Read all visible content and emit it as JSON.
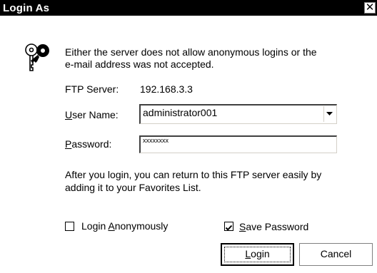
{
  "window": {
    "title": "Login As",
    "close_glyph": "✕"
  },
  "message": {
    "icon": "keys-icon",
    "line1": "Either the server does not allow anonymous logins or the",
    "line2": "e-mail address was not accepted."
  },
  "server": {
    "label": "FTP Server:",
    "value": "192.168.3.3"
  },
  "username": {
    "label_accel": "U",
    "label_rest": "ser Name:",
    "value": "administrator001"
  },
  "password": {
    "label_accel": "P",
    "label_rest": "assword:",
    "value": "xxxxxxxx"
  },
  "info": {
    "line1": "After you login, you can return to this FTP server easily by",
    "line2": "adding it to your Favorites List."
  },
  "options": {
    "anonymous": {
      "label_pre": "Login ",
      "label_accel": "A",
      "label_rest": "nonymously",
      "checked": false
    },
    "save_password": {
      "label_accel": "S",
      "label_rest": "ave Password",
      "checked": true
    }
  },
  "buttons": {
    "login": {
      "label_accel": "L",
      "label_rest": "ogin"
    },
    "cancel": {
      "label": "Cancel"
    }
  }
}
